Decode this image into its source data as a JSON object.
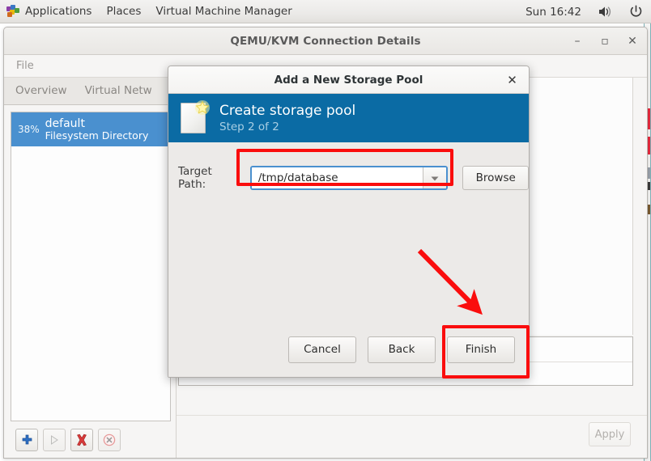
{
  "top_panel": {
    "logo_icon": "gnome-logo-icon",
    "items": [
      {
        "label": "Applications",
        "name": "applications-menu"
      },
      {
        "label": "Places",
        "name": "places-menu"
      },
      {
        "label": "Virtual Machine Manager",
        "name": "virtual-machine-manager-menu"
      }
    ],
    "clock": "Sun 16:42",
    "volume_icon": "speaker-icon",
    "power_icon": "power-icon"
  },
  "main_window": {
    "title": "QEMU/KVM Connection Details",
    "minimize_label": "–",
    "maximize_label": "▫",
    "close_label": "✕",
    "menubar": [
      {
        "label": "File",
        "name": "menu-file"
      }
    ],
    "tabs": [
      {
        "label": "Overview",
        "name": "tab-overview"
      },
      {
        "label": "Virtual Netw",
        "name": "tab-virtual-networks"
      }
    ],
    "pool_list": [
      {
        "percent": "38%",
        "name": "default",
        "type": "Filesystem Directory"
      }
    ],
    "toolbar": [
      {
        "name": "add-pool-button",
        "icon": "plus-icon",
        "enabled": true
      },
      {
        "name": "start-pool-button",
        "icon": "play-icon",
        "enabled": false
      },
      {
        "name": "stop-pool-button",
        "icon": "stop-x-icon",
        "enabled": true
      },
      {
        "name": "delete-pool-button",
        "icon": "delete-circle-icon",
        "enabled": false
      }
    ],
    "apply_label": "Apply"
  },
  "dialog": {
    "title": "Add a New Storage Pool",
    "close_label": "✕",
    "banner": {
      "icon": "new-document-icon",
      "heading": "Create storage pool",
      "step": "Step 2 of 2",
      "bg_color": "#0b6ba4"
    },
    "form": {
      "target_path_label": "Target Path:",
      "target_path_value": "/tmp/database",
      "target_path_placeholder": "",
      "dropdown_icon": "chevron-down-icon",
      "browse_label": "Browse"
    },
    "buttons": [
      {
        "label": "Cancel",
        "name": "cancel-button"
      },
      {
        "label": "Back",
        "name": "back-button"
      },
      {
        "label": "Finish",
        "name": "finish-button"
      }
    ]
  },
  "annotations": {
    "accent_color": "#fa0d0d",
    "highlight_target_path": true,
    "highlight_finish_button": true,
    "arrow_points_to": "finish-button"
  }
}
